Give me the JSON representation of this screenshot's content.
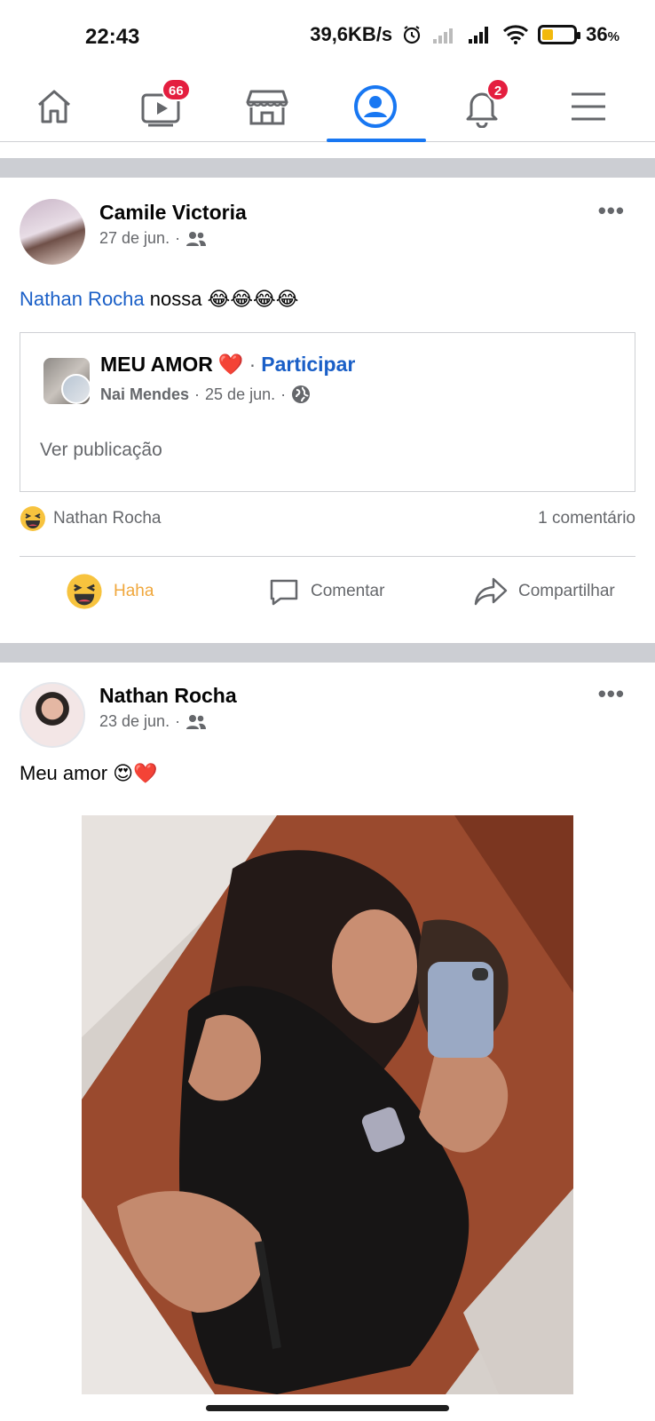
{
  "status_bar": {
    "time": "22:43",
    "speed": "39,6KB/s",
    "battery": "36",
    "battery_unit": "%",
    "battery_level": 0.36,
    "battery_color": "#f2b90d"
  },
  "nav": {
    "items": [
      {
        "name": "home",
        "icon": "home-icon"
      },
      {
        "name": "watch",
        "icon": "video-icon",
        "badge": "66"
      },
      {
        "name": "marketplace",
        "icon": "store-icon"
      },
      {
        "name": "profile",
        "icon": "profile-icon",
        "active": true
      },
      {
        "name": "notifications",
        "icon": "bell-icon",
        "badge": "2"
      },
      {
        "name": "menu",
        "icon": "hamburger-icon"
      }
    ],
    "accent": "#1877f2"
  },
  "posts": [
    {
      "author": "Camile Victoria",
      "date": "27 de jun.",
      "audience_icon": "friends-icon",
      "mention": "Nathan Rocha",
      "text": "nossa",
      "emojis": "😂😂😂😂",
      "shared": {
        "group_title": "MEU AMOR",
        "heart": "❤️",
        "join_label": "Participar",
        "poster": "Nai Mendes",
        "date": "25 de jun.",
        "privacy_icon": "globe-icon",
        "see_post": "Ver publicação"
      },
      "reaction_icon": "haha-icon",
      "reacted_by": "Nathan Rocha",
      "comment_count": "1 comentário",
      "actions": {
        "haha": "Haha",
        "comment": "Comentar",
        "share": "Compartilhar"
      }
    },
    {
      "author": "Nathan Rocha",
      "date": "23 de jun.",
      "audience_icon": "friends-icon",
      "text": "Meu amor",
      "emojis": "😍❤️"
    }
  ]
}
